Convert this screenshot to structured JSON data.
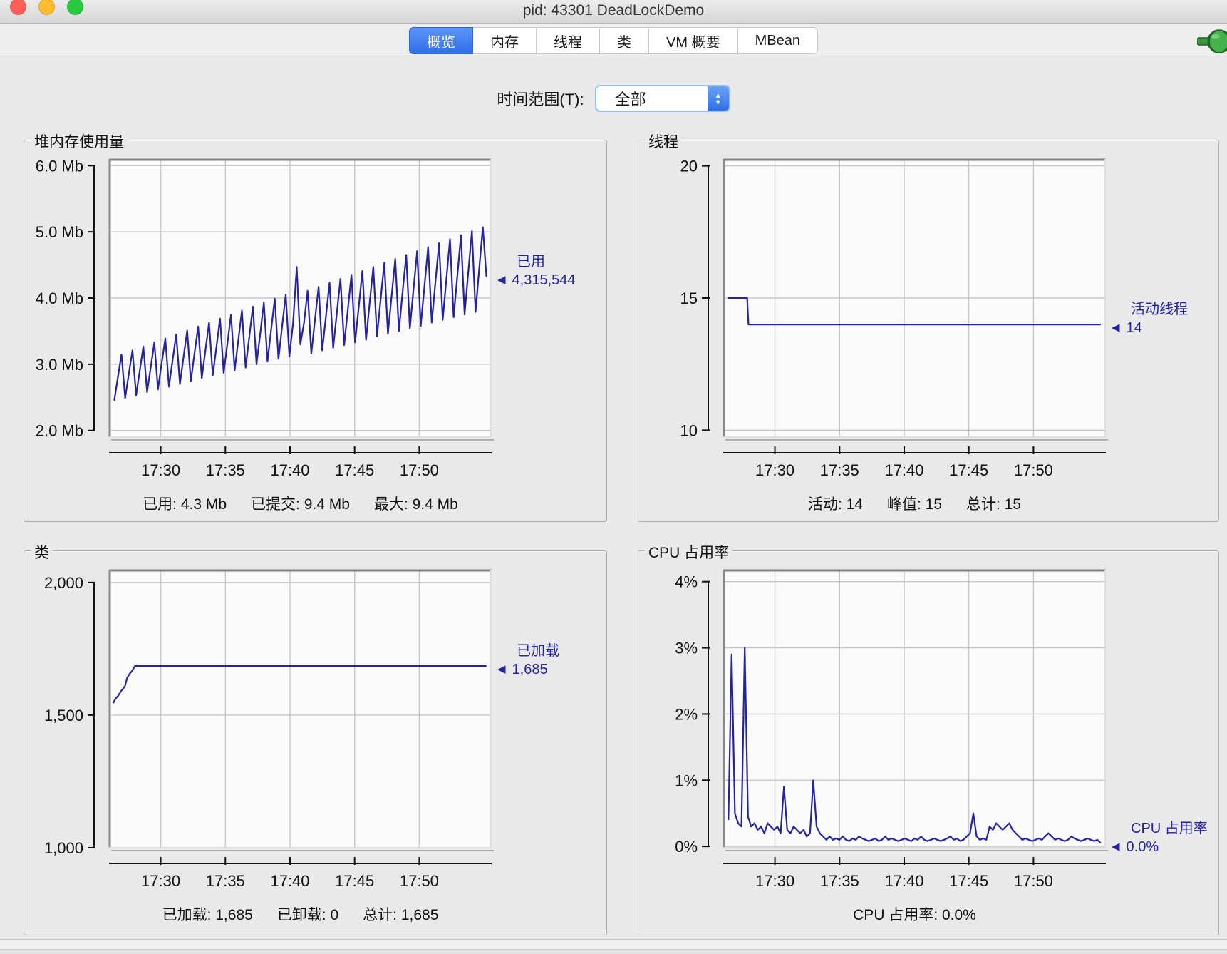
{
  "window": {
    "title": "pid: 43301 DeadLockDemo",
    "controls": [
      {
        "name": "close",
        "color": "#ff5f57"
      },
      {
        "name": "minimize",
        "color": "#febc2e"
      },
      {
        "name": "zoom",
        "color": "#28c840"
      }
    ],
    "status_icon": "plug-connected-icon"
  },
  "tabs": [
    {
      "label": "概览",
      "selected": true
    },
    {
      "label": "内存",
      "selected": false
    },
    {
      "label": "线程",
      "selected": false
    },
    {
      "label": "类",
      "selected": false
    },
    {
      "label": "VM 概要",
      "selected": false
    },
    {
      "label": "MBean",
      "selected": false
    }
  ],
  "accent_color": "#2f6fe8",
  "toolbar": {
    "time_range_label": "时间范围(T):",
    "time_range_value": "全部"
  },
  "chart_data": [
    {
      "id": "heap",
      "type": "line",
      "title": "堆内存使用量",
      "line_color": "#24249e",
      "xlim": [
        0,
        29.6
      ],
      "ylim": [
        1.9,
        6.1
      ],
      "yticks": [
        {
          "v": 6.0,
          "label": "6.0 Mb"
        },
        {
          "v": 5.0,
          "label": "5.0 Mb"
        },
        {
          "v": 4.0,
          "label": "4.0 Mb"
        },
        {
          "v": 3.0,
          "label": "3.0 Mb"
        },
        {
          "v": 2.0,
          "label": "2.0 Mb"
        }
      ],
      "xticks": [
        {
          "v": 4,
          "label": "17:30"
        },
        {
          "v": 9,
          "label": "17:35"
        },
        {
          "v": 14,
          "label": "17:40"
        },
        {
          "v": 19,
          "label": "17:45"
        },
        {
          "v": 24,
          "label": "17:50"
        }
      ],
      "series": [
        {
          "name": "已用",
          "x_start": 0.4,
          "x_end": 29.2,
          "values": [
            2.45,
            2.8,
            3.15,
            2.49,
            2.85,
            3.21,
            2.53,
            2.9,
            3.27,
            2.58,
            2.95,
            3.33,
            2.62,
            3.01,
            3.39,
            2.66,
            3.06,
            3.45,
            2.7,
            3.11,
            3.51,
            2.74,
            3.16,
            3.57,
            2.79,
            3.21,
            3.63,
            2.83,
            3.26,
            3.69,
            2.87,
            3.31,
            3.75,
            2.91,
            3.36,
            3.81,
            2.95,
            3.41,
            3.87,
            3.0,
            3.46,
            3.93,
            3.04,
            3.52,
            3.99,
            3.08,
            3.57,
            4.05,
            3.12,
            3.62,
            4.47,
            3.3,
            3.62,
            4.11,
            3.16,
            3.67,
            4.17,
            3.21,
            3.72,
            4.23,
            3.25,
            3.77,
            4.29,
            3.29,
            3.82,
            4.35,
            3.33,
            3.87,
            4.41,
            3.37,
            3.93,
            4.47,
            3.42,
            3.98,
            4.53,
            3.46,
            4.03,
            4.59,
            3.5,
            4.08,
            4.65,
            3.54,
            4.13,
            4.71,
            3.58,
            4.18,
            4.77,
            3.63,
            4.23,
            4.83,
            3.67,
            4.28,
            4.89,
            3.71,
            4.33,
            4.95,
            3.75,
            4.38,
            5.01,
            3.79,
            4.44,
            5.07,
            4.32
          ]
        }
      ],
      "legend": {
        "name": "已用",
        "value": "4,315,544"
      },
      "summary": [
        {
          "label": "已用",
          "value": "4.3 Mb"
        },
        {
          "label": "已提交",
          "value": "9.4 Mb"
        },
        {
          "label": "最大",
          "value": "9.4 Mb"
        }
      ]
    },
    {
      "id": "threads",
      "type": "line",
      "title": "线程",
      "line_color": "#24249e",
      "xlim": [
        0,
        29.6
      ],
      "ylim": [
        9.74,
        20.26
      ],
      "yticks": [
        {
          "v": 20,
          "label": "20"
        },
        {
          "v": 15,
          "label": "15"
        },
        {
          "v": 10,
          "label": "10"
        }
      ],
      "xticks": [
        {
          "v": 4,
          "label": "17:30"
        },
        {
          "v": 9,
          "label": "17:35"
        },
        {
          "v": 14,
          "label": "17:40"
        },
        {
          "v": 19,
          "label": "17:45"
        },
        {
          "v": 24,
          "label": "17:50"
        }
      ],
      "series": [
        {
          "name": "活动线程",
          "points": [
            [
              0.33,
              15
            ],
            [
              1.85,
              15
            ],
            [
              1.95,
              14
            ],
            [
              29.2,
              14
            ]
          ]
        }
      ],
      "legend": {
        "name": "活动线程",
        "value": "14"
      },
      "summary": [
        {
          "label": "活动",
          "value": "14"
        },
        {
          "label": "峰值",
          "value": "15"
        },
        {
          "label": "总计",
          "value": "15"
        }
      ]
    },
    {
      "id": "classes",
      "type": "line",
      "title": "类",
      "line_color": "#24249e",
      "xlim": [
        0,
        29.6
      ],
      "ylim": [
        1000,
        2048
      ],
      "yticks": [
        {
          "v": 2000,
          "label": "2,000"
        },
        {
          "v": 1500,
          "label": "1,500"
        },
        {
          "v": 1000,
          "label": "1,000"
        }
      ],
      "xticks": [
        {
          "v": 4,
          "label": "17:30"
        },
        {
          "v": 9,
          "label": "17:35"
        },
        {
          "v": 14,
          "label": "17:40"
        },
        {
          "v": 19,
          "label": "17:45"
        },
        {
          "v": 24,
          "label": "17:50"
        }
      ],
      "series": [
        {
          "name": "已加载",
          "points": [
            [
              0.33,
              1545
            ],
            [
              0.45,
              1558
            ],
            [
              0.55,
              1565
            ],
            [
              0.7,
              1572
            ],
            [
              0.8,
              1580
            ],
            [
              0.95,
              1592
            ],
            [
              1.1,
              1600
            ],
            [
              1.25,
              1612
            ],
            [
              1.4,
              1640
            ],
            [
              1.6,
              1656
            ],
            [
              1.8,
              1668
            ],
            [
              2.0,
              1685
            ],
            [
              29.2,
              1685
            ]
          ]
        }
      ],
      "legend": {
        "name": "已加载",
        "value": "1,685"
      },
      "summary": [
        {
          "label": "已加载",
          "value": "1,685"
        },
        {
          "label": "已卸载",
          "value": "0"
        },
        {
          "label": "总计",
          "value": "1,685"
        }
      ]
    },
    {
      "id": "cpu",
      "type": "line",
      "title": "CPU 占用率",
      "line_color": "#24249e",
      "xlim": [
        0,
        29.6
      ],
      "ylim": [
        -0.02,
        4.18
      ],
      "yticks": [
        {
          "v": 4,
          "label": "4%"
        },
        {
          "v": 3,
          "label": "3%"
        },
        {
          "v": 2,
          "label": "2%"
        },
        {
          "v": 1,
          "label": "1%"
        },
        {
          "v": 0,
          "label": "0%"
        }
      ],
      "xticks": [
        {
          "v": 4,
          "label": "17:30"
        },
        {
          "v": 9,
          "label": "17:35"
        },
        {
          "v": 14,
          "label": "17:40"
        },
        {
          "v": 19,
          "label": "17:45"
        },
        {
          "v": 24,
          "label": "17:50"
        }
      ],
      "series": [
        {
          "name": "CPU 占用率",
          "x_start": 0.4,
          "x_end": 29.2,
          "values": [
            0.4,
            2.9,
            0.5,
            0.35,
            0.3,
            3.0,
            0.45,
            0.3,
            0.35,
            0.25,
            0.3,
            0.2,
            0.35,
            0.3,
            0.25,
            0.3,
            0.2,
            0.9,
            0.25,
            0.2,
            0.3,
            0.25,
            0.2,
            0.25,
            0.15,
            0.2,
            1.0,
            0.3,
            0.2,
            0.15,
            0.1,
            0.15,
            0.1,
            0.12,
            0.1,
            0.15,
            0.1,
            0.08,
            0.12,
            0.1,
            0.15,
            0.12,
            0.1,
            0.08,
            0.1,
            0.12,
            0.08,
            0.1,
            0.15,
            0.1,
            0.12,
            0.1,
            0.08,
            0.1,
            0.12,
            0.1,
            0.08,
            0.12,
            0.1,
            0.15,
            0.1,
            0.08,
            0.1,
            0.12,
            0.1,
            0.08,
            0.1,
            0.12,
            0.15,
            0.1,
            0.12,
            0.08,
            0.1,
            0.15,
            0.2,
            0.5,
            0.15,
            0.1,
            0.12,
            0.1,
            0.3,
            0.25,
            0.35,
            0.3,
            0.25,
            0.3,
            0.35,
            0.25,
            0.2,
            0.15,
            0.1,
            0.12,
            0.1,
            0.08,
            0.1,
            0.12,
            0.1,
            0.15,
            0.2,
            0.15,
            0.1,
            0.12,
            0.1,
            0.08,
            0.1,
            0.15,
            0.12,
            0.1,
            0.08,
            0.1,
            0.12,
            0.1,
            0.08,
            0.1,
            0.05
          ]
        }
      ],
      "legend": {
        "name": "CPU 占用率",
        "value": "0.0%"
      },
      "summary": [
        {
          "label": "CPU 占用率",
          "value": "0.0%"
        }
      ]
    }
  ]
}
